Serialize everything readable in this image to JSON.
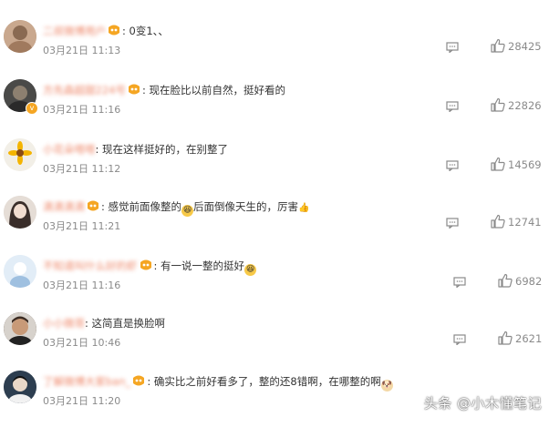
{
  "comments": [
    {
      "user": "二叔微博用户",
      "text": "0变1、、",
      "time": "03月21日 11:13",
      "likes": "28425",
      "avatar_color": "#b08a6e",
      "verified": false
    },
    {
      "user": "方先森超甜224号",
      "text": "现在脸比以前自然，挺好看的",
      "time": "03月21日 11:16",
      "likes": "22826",
      "avatar_color": "#3c3c3c",
      "verified": true
    },
    {
      "user": "小花朵嗒嗒",
      "text": "现在这样挺好的，在别整了",
      "time": "03月21日 11:12",
      "likes": "14569",
      "avatar_color": "#f4c842",
      "verified": false
    },
    {
      "user": "滴滴滴滴",
      "text_before": "感觉前面像整的",
      "text_after": "后面倒像天生的，厉害",
      "time": "03月21日 11:21",
      "likes": "12741",
      "avatar_color": "#c9b7b0",
      "verified": false
    },
    {
      "user": "不知道叫什么好的虾",
      "text": "有一说一整的挺好",
      "time": "03月21日 11:16",
      "likes": "6982",
      "avatar_color": "#c7dcef",
      "verified": false
    },
    {
      "user": "小小微哥",
      "text": "这简直是换脸啊",
      "time": "03月21日 10:46",
      "likes": "2621",
      "avatar_color": "#6b5a4e",
      "verified": false
    },
    {
      "user": "了解微博大家ban_",
      "text": "确实比之前好看多了，整的还8错啊，在哪整的啊",
      "time": "03月21日 11:20",
      "likes": "",
      "avatar_color": "#2b3a4a",
      "verified": false
    }
  ],
  "watermark": "头条 @小木懂笔记",
  "colors": {
    "username": "#eb7350",
    "meta": "#8a8a8a",
    "badge": "#f5a623"
  }
}
